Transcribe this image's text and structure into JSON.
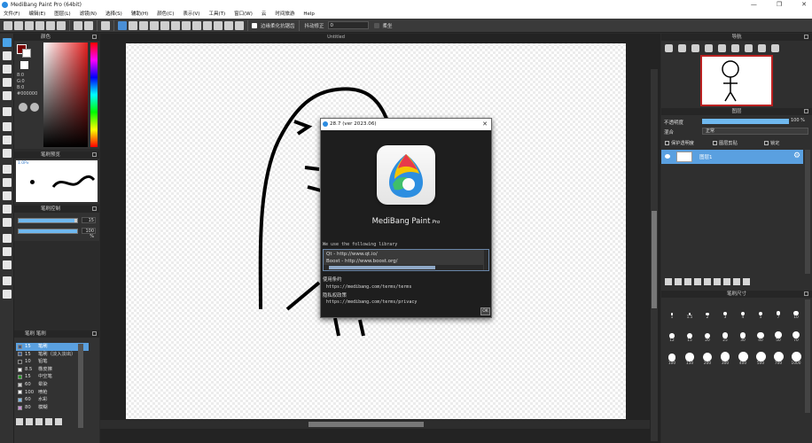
{
  "window": {
    "title": "MediBang Paint Pro (64bit)",
    "min_label": "—",
    "max_label": "❐",
    "close_label": "✕"
  },
  "menu": [
    "文件(F)",
    "编辑(E)",
    "图层(L)",
    "滤镜(N)",
    "选择(S)",
    "辅助(H)",
    "颜色(C)",
    "表示(V)",
    "工具(T)",
    "窗口(W)",
    "云",
    "时间旅游",
    "Help"
  ],
  "toolbar": {
    "antialias_label": "边缘柔化抗锯齿",
    "correction_label": "抖动修正",
    "correction_value": "0",
    "follow_label": "柔坐"
  },
  "color_panel": {
    "title": "颜色",
    "values": [
      "8:0",
      "G:0",
      "B:0",
      "#000000"
    ]
  },
  "brush_preview": {
    "title": "笔刷预览",
    "size_label": "1.0Px"
  },
  "brush_control": {
    "title": "笔刷控制",
    "size": "15",
    "size_value": 0.95,
    "opacity": "100 %",
    "opacity_value": 1.0
  },
  "brush_list": {
    "header": "笔刷 笔刷",
    "items": [
      {
        "size": "15",
        "name": "笔刷",
        "color": "#3b5a8a",
        "selected": true
      },
      {
        "size": "15",
        "name": "笔刷（淡入淡出）",
        "color": "#3b5a8a",
        "selected": false
      },
      {
        "size": "10",
        "name": "铅笔",
        "color": "#303030",
        "selected": false
      },
      {
        "size": "8.5",
        "name": "橡皮擦",
        "color": "#ffffff",
        "selected": false
      },
      {
        "size": "15",
        "name": "中空笔",
        "color": "#2a9d2a",
        "selected": false
      },
      {
        "size": "60",
        "name": "晕染",
        "color": "#cfcfcf",
        "selected": false
      },
      {
        "size": "100",
        "name": "喷枪",
        "color": "#ffffff",
        "selected": false
      },
      {
        "size": "60",
        "name": "水彩",
        "color": "#7ab8e8",
        "selected": false
      },
      {
        "size": "80",
        "name": "模糊",
        "color": "#c88fd6",
        "selected": false
      }
    ]
  },
  "document": {
    "tab": "Untitled"
  },
  "about_dialog": {
    "title": "28.7 (ver 2023.06)",
    "app_name": "MediBang Paint",
    "edition": "Pro",
    "lib_intro": "We use the following library",
    "libraries": [
      "Qt - http://www.qt.io/",
      "Boost - http://www.boost.org/"
    ],
    "terms_label": "使用条约",
    "terms_url": "https://medibang.com/terms/terms",
    "privacy_label": "隐私权政策",
    "privacy_url": "https://medibang.com/terms/privacy",
    "ok_label": "OK"
  },
  "navigator": {
    "title": "导航"
  },
  "layers": {
    "title": "图层",
    "opacity_label": "不透明度",
    "opacity_value": "100 %",
    "blend_label": "混合",
    "blend_value": "正常",
    "protect_label": "保护透明度",
    "clip_label": "图层剪贴",
    "lock_label": "锁定",
    "items": [
      {
        "name": "图层1",
        "selected": true
      }
    ]
  },
  "brush_size": {
    "title": "笔刷尺寸",
    "sizes": [
      "1",
      "1.5",
      "2",
      "3",
      "4",
      "5",
      "7",
      "10",
      "12",
      "15",
      "20",
      "25",
      "30",
      "40",
      "50",
      "70",
      "100",
      "150",
      "200",
      "300",
      "400",
      "500",
      "700",
      "1000"
    ]
  }
}
